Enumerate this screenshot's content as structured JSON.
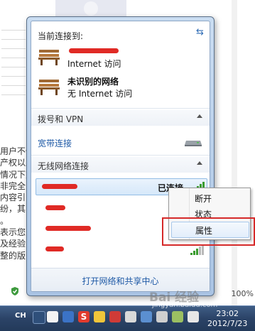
{
  "background_page": {
    "text_lines": [
      "用户不信",
      "产权以上",
      "情况下对",
      "非完全",
      "内容引",
      "纷，其",
      "。",
      "表示您",
      "及经验",
      "整的版"
    ],
    "link_text": "经验",
    "zoom_percent": "100%"
  },
  "flyout": {
    "current_connection_title": "当前连接到:",
    "refresh_icon": "refresh-arrows-icon",
    "connections": [
      {
        "name": "",
        "status": "Internet 访问",
        "icon": "network-bench-icon"
      },
      {
        "name": "未识别的网络",
        "status": "无 Internet 访问",
        "icon": "network-bench-icon"
      }
    ],
    "dialup_vpn_group": "拨号和 VPN",
    "broadband_label": "宽带连接",
    "wireless_group": "无线网络连接",
    "wireless_networks": [
      {
        "name": "",
        "status": "已连接",
        "signal": 5,
        "selected": true
      },
      {
        "name": "",
        "status": "",
        "signal": 5,
        "selected": false
      },
      {
        "name": "",
        "status": "",
        "signal": 5,
        "selected": false
      },
      {
        "name": "",
        "status": "",
        "signal": 3,
        "selected": false
      }
    ],
    "open_center_link": "打开网络和共享中心"
  },
  "context_menu": {
    "items": [
      "断开",
      "状态",
      "属性"
    ],
    "hovered_item": "属性"
  },
  "taskbar": {
    "input_method": "CH",
    "time": "23:02",
    "date": "2012/7/23"
  },
  "watermark": {
    "text": "Bai 经验",
    "subtext": "jingyan.baidu.com"
  },
  "colors": {
    "accent_link": "#1f5aa6",
    "signal_green": "#3a9c2f",
    "highlight_red": "#d52a2a"
  }
}
